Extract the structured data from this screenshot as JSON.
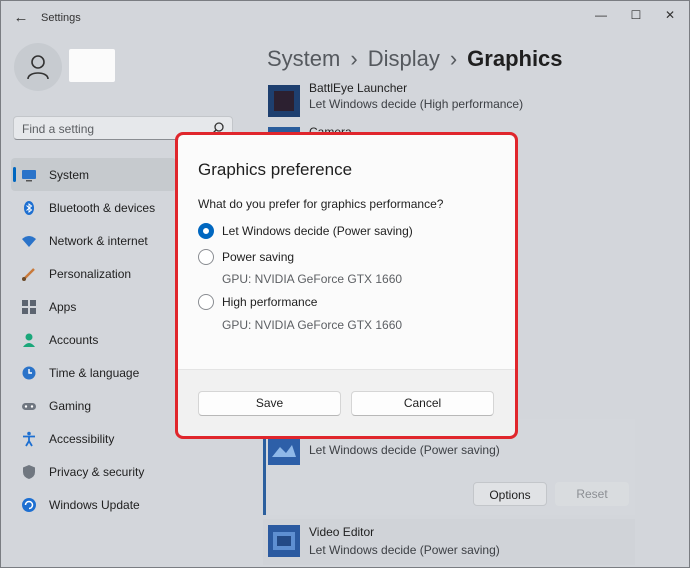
{
  "window": {
    "title": "Settings",
    "back_icon": "back-arrow-icon",
    "controls": [
      "minimize-icon",
      "maximize-icon",
      "close-icon"
    ]
  },
  "sidebar": {
    "search_placeholder": "Find a setting",
    "items": [
      {
        "label": "System",
        "icon": "monitor-icon",
        "active": true
      },
      {
        "label": "Bluetooth & devices",
        "icon": "bluetooth-icon"
      },
      {
        "label": "Network & internet",
        "icon": "wifi-icon"
      },
      {
        "label": "Personalization",
        "icon": "brush-icon"
      },
      {
        "label": "Apps",
        "icon": "apps-icon"
      },
      {
        "label": "Accounts",
        "icon": "person-icon"
      },
      {
        "label": "Time & language",
        "icon": "globe-clock-icon"
      },
      {
        "label": "Gaming",
        "icon": "gamepad-icon"
      },
      {
        "label": "Accessibility",
        "icon": "accessibility-icon"
      },
      {
        "label": "Privacy & security",
        "icon": "shield-icon"
      },
      {
        "label": "Windows Update",
        "icon": "update-icon"
      }
    ]
  },
  "breadcrumb": {
    "items": [
      "System",
      "Display"
    ],
    "current": "Graphics",
    "separator": "›"
  },
  "apps": [
    {
      "name": "BattlEye Launcher",
      "pref": "Let Windows decide (High performance)"
    },
    {
      "name": "Camera",
      "pref": ""
    },
    {
      "name": "",
      "pref": "Let Windows decide (Power saving)"
    },
    {
      "name": "Video Editor",
      "pref": "Let Windows decide (Power saving)"
    }
  ],
  "expanded_actions": {
    "options": "Options",
    "reset": "Reset"
  },
  "dialog": {
    "title": "Graphics preference",
    "question": "What do you prefer for graphics performance?",
    "options": [
      {
        "label": "Let Windows decide (Power saving)",
        "sub": "",
        "checked": true
      },
      {
        "label": "Power saving",
        "sub": "GPU: NVIDIA GeForce GTX 1660",
        "checked": false
      },
      {
        "label": "High performance",
        "sub": "GPU: NVIDIA GeForce GTX 1660",
        "checked": false
      }
    ],
    "save": "Save",
    "cancel": "Cancel"
  },
  "colors": {
    "accent": "#0067c0",
    "highlight": "#e0262c"
  }
}
